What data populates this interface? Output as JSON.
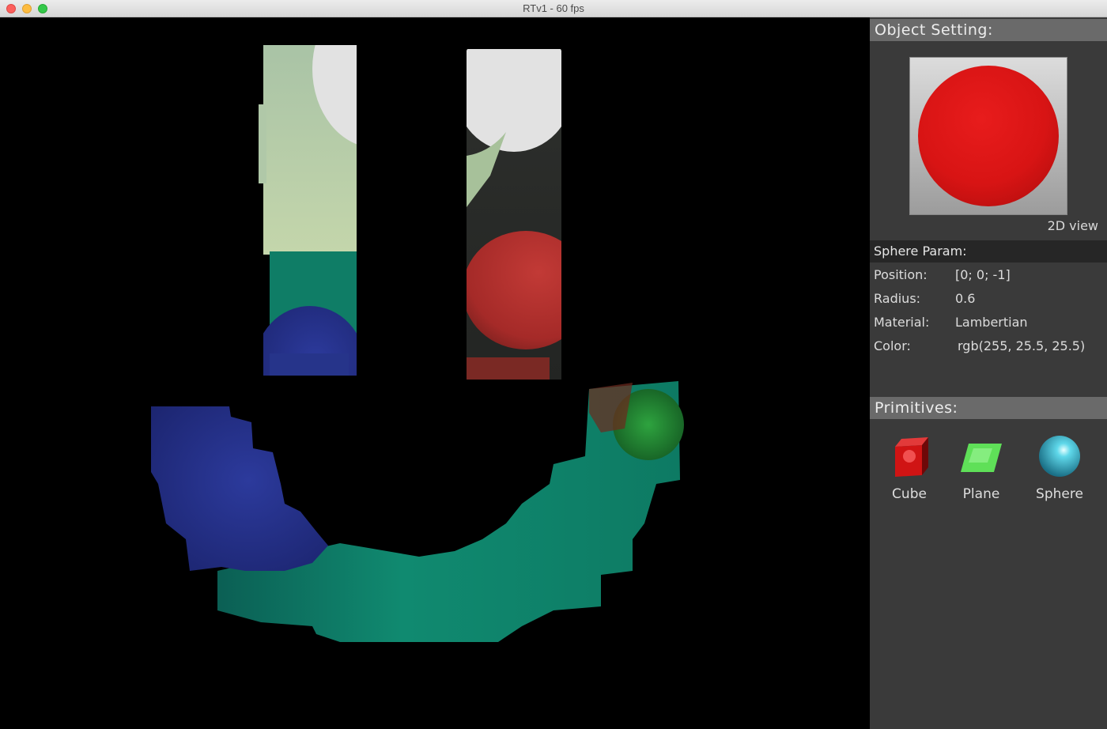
{
  "window": {
    "title": "RTv1 - 60 fps"
  },
  "panel": {
    "object_header": "Object Setting:",
    "preview_label": "2D view",
    "preview_color": "#d81414",
    "params_header": "Sphere Param:",
    "params": [
      {
        "key": "Position:",
        "value": "[0; 0; -1]"
      },
      {
        "key": "Radius:",
        "value": "0.6"
      },
      {
        "key": "Material:",
        "value": "Lambertian"
      },
      {
        "key": "Color:",
        "value": "rgb(255, 25.5, 25.5)"
      }
    ],
    "primitives_header": "Primitives:",
    "primitives": [
      {
        "label": "Cube",
        "icon": "cube-icon"
      },
      {
        "label": "Plane",
        "icon": "plane-icon"
      },
      {
        "label": "Sphere",
        "icon": "sphere-icon"
      }
    ]
  },
  "colors": {
    "panel_bg": "#3a3a3a",
    "header_bg": "#6a6a6a",
    "teal": "#0f8a6e",
    "blue": "#27348f",
    "red": "#b3312f",
    "pale_green": "#b8cfa5",
    "green": "#1f8a35"
  }
}
